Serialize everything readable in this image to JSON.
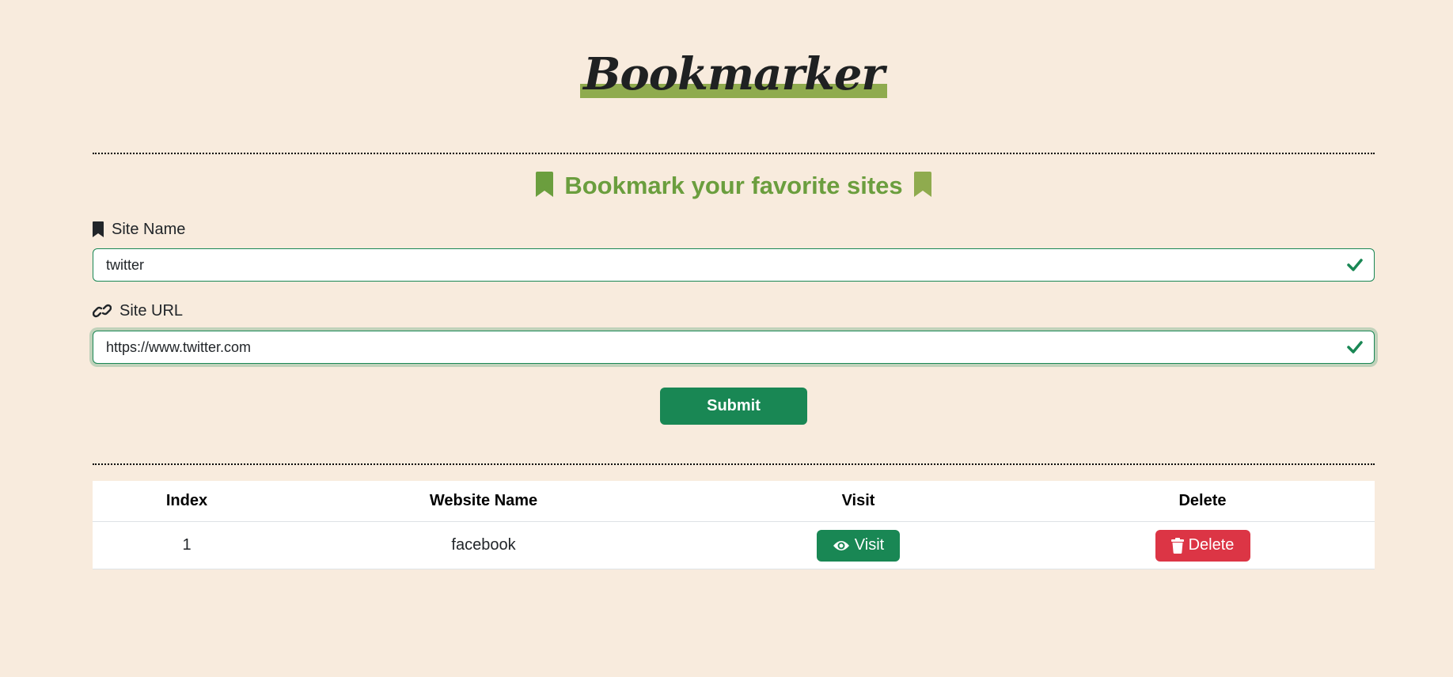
{
  "app": {
    "title": "Bookmarker"
  },
  "form": {
    "heading": "Bookmark your favorite sites",
    "site_name_label": "Site Name",
    "site_name_value": "twitter",
    "site_url_label": "Site URL",
    "site_url_value": "https://www.twitter.com",
    "submit_label": "Submit"
  },
  "table": {
    "headers": [
      "Index",
      "Website Name",
      "Visit",
      "Delete"
    ],
    "rows": [
      {
        "index": "1",
        "name": "facebook",
        "visit_label": "Visit",
        "delete_label": "Delete"
      }
    ]
  },
  "colors": {
    "background": "#f8ebdd",
    "accent_green": "#198754",
    "title_green": "#6b9e3e",
    "logo_highlight": "#8fab4e",
    "danger_red": "#dc3545"
  },
  "icons": {
    "heading_left": "bookmark-icon",
    "heading_right": "bookmark-icon",
    "site_name": "bookmark-icon",
    "site_url": "link-icon",
    "valid": "check-icon",
    "visit": "eye-icon",
    "delete": "trash-icon"
  }
}
